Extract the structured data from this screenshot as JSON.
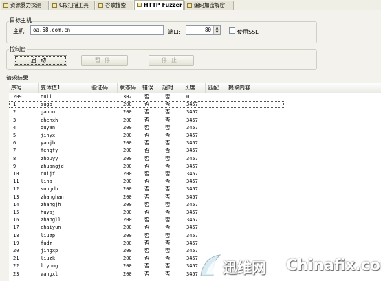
{
  "tabs": [
    {
      "label": "资源暴力探测",
      "active": false
    },
    {
      "label": "C段扫描工具",
      "active": false
    },
    {
      "label": "谷歌搜索",
      "active": false
    },
    {
      "label": "HTTP Fuzzer",
      "active": true
    },
    {
      "label": "编码加密解密",
      "active": false
    }
  ],
  "target_group": {
    "title": "目标主机",
    "host_label": "主机:",
    "host_value": "oa.58.com.cn",
    "port_label": "端口:",
    "port_value": "80",
    "ssl_label": "使用SSL",
    "ssl_checked": false
  },
  "control_group": {
    "title": "控制台",
    "start_label": "启动",
    "pause_label": "暂停",
    "stop_label": "停止"
  },
  "results": {
    "title": "请求结果",
    "columns": [
      "序号",
      "变体值1",
      "验证码",
      "状态码",
      "错误",
      "超时",
      "长度",
      "匹配",
      "提取内容"
    ],
    "rows": [
      [
        "209",
        "null",
        "",
        "302",
        "否",
        "否",
        "0",
        "",
        ""
      ],
      [
        "1",
        "sugp",
        "",
        "200",
        "否",
        "否",
        "3457",
        "",
        ""
      ],
      [
        "2",
        "gaobo",
        "",
        "200",
        "否",
        "否",
        "3457",
        "",
        ""
      ],
      [
        "3",
        "chenxh",
        "",
        "200",
        "否",
        "否",
        "3457",
        "",
        ""
      ],
      [
        "4",
        "duyan",
        "",
        "200",
        "否",
        "否",
        "3457",
        "",
        ""
      ],
      [
        "5",
        "jinyx",
        "",
        "200",
        "否",
        "否",
        "3457",
        "",
        ""
      ],
      [
        "6",
        "yaojb",
        "",
        "200",
        "否",
        "否",
        "3457",
        "",
        ""
      ],
      [
        "7",
        "fengfy",
        "",
        "200",
        "否",
        "否",
        "3457",
        "",
        ""
      ],
      [
        "8",
        "zhouyy",
        "",
        "200",
        "否",
        "否",
        "3457",
        "",
        ""
      ],
      [
        "9",
        "zhuangjd",
        "",
        "200",
        "否",
        "否",
        "3457",
        "",
        ""
      ],
      [
        "10",
        "cuijf",
        "",
        "200",
        "否",
        "否",
        "3457",
        "",
        ""
      ],
      [
        "11",
        "lina",
        "",
        "200",
        "否",
        "否",
        "3457",
        "",
        ""
      ],
      [
        "12",
        "songdh",
        "",
        "200",
        "否",
        "否",
        "3457",
        "",
        ""
      ],
      [
        "13",
        "zhanghan",
        "",
        "200",
        "否",
        "否",
        "3457",
        "",
        ""
      ],
      [
        "14",
        "zhangjh",
        "",
        "200",
        "否",
        "否",
        "3457",
        "",
        ""
      ],
      [
        "15",
        "huyaj",
        "",
        "200",
        "否",
        "否",
        "3457",
        "",
        ""
      ],
      [
        "16",
        "zhangll",
        "",
        "200",
        "否",
        "否",
        "3457",
        "",
        ""
      ],
      [
        "17",
        "chaiyun",
        "",
        "200",
        "否",
        "否",
        "3457",
        "",
        ""
      ],
      [
        "18",
        "liuzp",
        "",
        "200",
        "否",
        "否",
        "3457",
        "",
        ""
      ],
      [
        "19",
        "fudm",
        "",
        "200",
        "否",
        "否",
        "3457",
        "",
        ""
      ],
      [
        "20",
        "jingxp",
        "",
        "200",
        "否",
        "否",
        "3457",
        "",
        ""
      ],
      [
        "21",
        "liuzk",
        "",
        "200",
        "否",
        "否",
        "3457",
        "",
        ""
      ],
      [
        "22",
        "liyong",
        "",
        "200",
        "否",
        "否",
        "3457",
        "",
        ""
      ],
      [
        "23",
        "wangxl",
        "",
        "200",
        "否",
        "否",
        "3457",
        "",
        ""
      ]
    ],
    "selected_row": 1
  },
  "watermark": {
    "cn_text": "迅维网",
    "en_text": "Chinafix.com"
  },
  "colors": {
    "window_bg": "#f3f2ec",
    "grid_bg": "#ffffff",
    "button_disabled_text": "#a8a79e"
  }
}
